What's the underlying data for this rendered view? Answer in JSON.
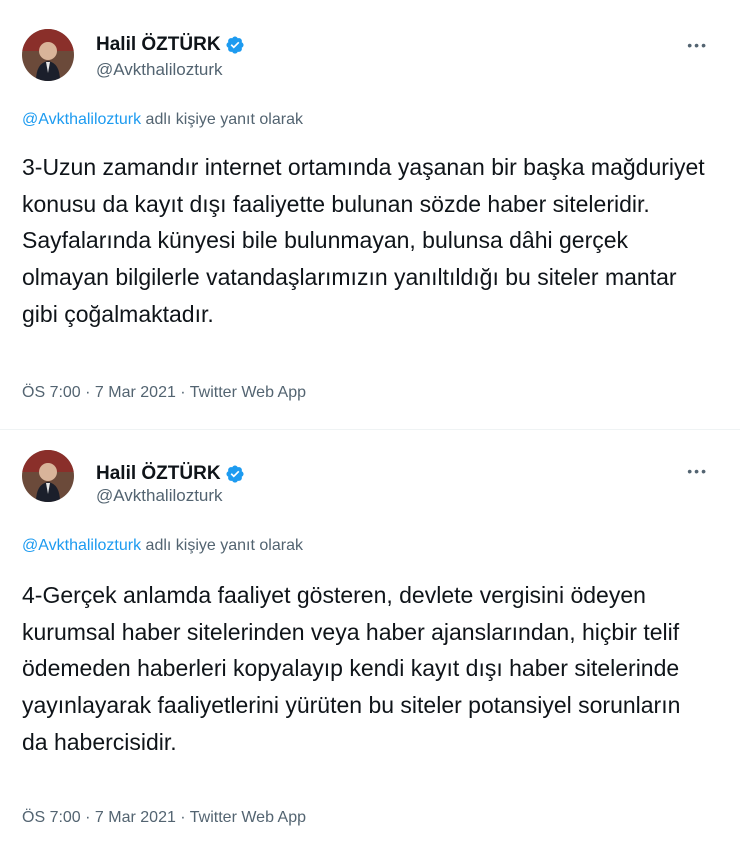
{
  "tweets": [
    {
      "author": {
        "name": "Halil ÖZTÜRK",
        "handle": "@Avkthalilozturk",
        "verified": true
      },
      "reply": {
        "mention": "@Avkthalilozturk",
        "suffix": " adlı kişiye yanıt olarak"
      },
      "text": "3-Uzun zamandır internet ortamında yaşanan bir başka mağduriyet konusu da kayıt dışı faaliyette bulunan sözde haber siteleridir. Sayfalarında künyesi bile bulunmayan, bulunsa dâhi gerçek olmayan bilgilerle vatandaşlarımızın yanıltıldığı bu siteler mantar gibi çoğalmaktadır.",
      "meta": "ÖS 7:00 · 7 Mar 2021 · Twitter Web App"
    },
    {
      "author": {
        "name": "Halil ÖZTÜRK",
        "handle": "@Avkthalilozturk",
        "verified": true
      },
      "reply": {
        "mention": "@Avkthalilozturk",
        "suffix": " adlı kişiye yanıt olarak"
      },
      "text": "4-Gerçek anlamda faaliyet gösteren, devlete vergisini ödeyen kurumsal haber sitelerinden veya haber ajanslarından, hiçbir telif ödemeden haberleri kopyalayıp kendi kayıt dışı haber sitelerinde yayınlayarak faaliyetlerini yürüten bu siteler potansiyel sorunların da habercisidir.",
      "meta": "ÖS 7:00 · 7 Mar 2021 · Twitter Web App"
    }
  ],
  "icons": {
    "verified": "verified-badge-icon",
    "more": "more-options-icon"
  },
  "colors": {
    "link": "#1d9bf0",
    "verified": "#1d9bf0",
    "secondary": "#536471",
    "text": "#0f1419"
  }
}
